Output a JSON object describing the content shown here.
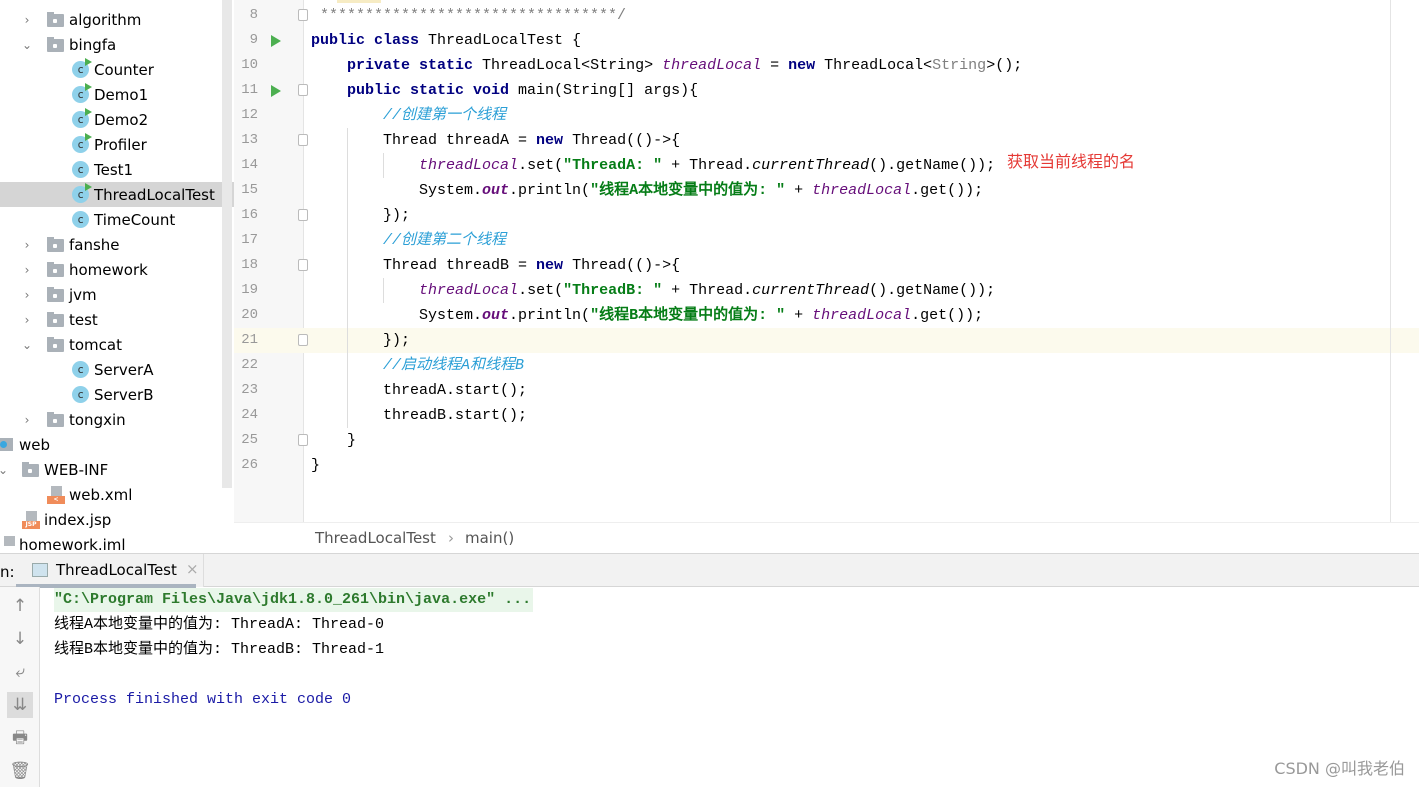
{
  "sidebar": {
    "items": [
      {
        "label": "algorithm",
        "type": "folder",
        "expanded": false
      },
      {
        "label": "bingfa",
        "type": "folder",
        "expanded": true
      },
      {
        "label": "Counter",
        "type": "class-runnable"
      },
      {
        "label": "Demo1",
        "type": "class-runnable"
      },
      {
        "label": "Demo2",
        "type": "class-runnable"
      },
      {
        "label": "Profiler",
        "type": "class-runnable"
      },
      {
        "label": "Test1",
        "type": "class"
      },
      {
        "label": "ThreadLocalTest",
        "type": "class-runnable",
        "selected": true
      },
      {
        "label": "TimeCount",
        "type": "class"
      },
      {
        "label": "fanshe",
        "type": "folder",
        "expanded": false
      },
      {
        "label": "homework",
        "type": "folder",
        "expanded": false
      },
      {
        "label": "jvm",
        "type": "folder",
        "expanded": false
      },
      {
        "label": "test",
        "type": "folder",
        "expanded": false
      },
      {
        "label": "tomcat",
        "type": "folder",
        "expanded": true
      },
      {
        "label": "ServerA",
        "type": "class"
      },
      {
        "label": "ServerB",
        "type": "class"
      },
      {
        "label": "tongxin",
        "type": "folder",
        "expanded": false
      },
      {
        "label": "web",
        "type": "web-folder"
      },
      {
        "label": "WEB-INF",
        "type": "folder",
        "expanded": true
      },
      {
        "label": "web.xml",
        "type": "xml-file",
        "tag": "<"
      },
      {
        "label": "index.jsp",
        "type": "jsp-file",
        "tag": "JSP"
      },
      {
        "label": "homework.iml",
        "type": "iml-file"
      }
    ]
  },
  "editor": {
    "colors": {
      "kw": "#000080",
      "cls": "#000000",
      "field": "#660e7a",
      "comment": "#2b9fd6",
      "str": "#067d17",
      "plain": "#000000",
      "gray": "#808080"
    },
    "lines": [
      {
        "n": "8",
        "fold": true,
        "tokens": [
          {
            "t": " *********************************/",
            "c": "gray"
          }
        ]
      },
      {
        "n": "9",
        "run": true,
        "tokens": [
          {
            "t": "public class ",
            "c": "kw",
            "b": 1
          },
          {
            "t": "ThreadLocalTest {",
            "c": "plain"
          }
        ]
      },
      {
        "n": "10",
        "tokens": [
          {
            "t": "    "
          },
          {
            "t": "private static ",
            "c": "kw",
            "b": 1
          },
          {
            "t": "ThreadLocal<String> ",
            "c": "plain"
          },
          {
            "t": "threadLocal",
            "c": "field",
            "i": 1
          },
          {
            "t": " = "
          },
          {
            "t": "new ",
            "c": "kw",
            "b": 1
          },
          {
            "t": "ThreadLocal<"
          },
          {
            "t": "String",
            "c": "gray"
          },
          {
            "t": ">();"
          }
        ]
      },
      {
        "n": "11",
        "run": true,
        "fold": true,
        "tokens": [
          {
            "t": "    "
          },
          {
            "t": "public static void ",
            "c": "kw",
            "b": 1
          },
          {
            "t": "main(String[] args){"
          }
        ]
      },
      {
        "n": "12",
        "tokens": [
          {
            "t": "        "
          },
          {
            "t": "//创建第一个线程",
            "c": "comment",
            "i": 1
          }
        ]
      },
      {
        "n": "13",
        "fold": true,
        "tokens": [
          {
            "t": "        Thread threadA = "
          },
          {
            "t": "new ",
            "c": "kw",
            "b": 1
          },
          {
            "t": "Thread(()->{"
          }
        ]
      },
      {
        "n": "14",
        "tokens": [
          {
            "t": "            "
          },
          {
            "t": "threadLocal",
            "c": "field",
            "i": 1
          },
          {
            "t": ".set("
          },
          {
            "t": "\"ThreadA: \"",
            "c": "str",
            "b": 1
          },
          {
            "t": " + Thread."
          },
          {
            "t": "currentThread",
            "i": 1
          },
          {
            "t": "().getName());"
          }
        ]
      },
      {
        "n": "15",
        "tokens": [
          {
            "t": "            System."
          },
          {
            "t": "out",
            "c": "field",
            "b": 1,
            "i": 1
          },
          {
            "t": ".println("
          },
          {
            "t": "\"线程A本地变量中的值为: \"",
            "c": "str",
            "b": 1
          },
          {
            "t": " + "
          },
          {
            "t": "threadLocal",
            "c": "field",
            "i": 1
          },
          {
            "t": ".get());"
          }
        ]
      },
      {
        "n": "16",
        "fold": true,
        "tokens": [
          {
            "t": "        });"
          }
        ]
      },
      {
        "n": "17",
        "tokens": [
          {
            "t": "        "
          },
          {
            "t": "//创建第二个线程",
            "c": "comment",
            "i": 1
          }
        ]
      },
      {
        "n": "18",
        "fold": true,
        "tokens": [
          {
            "t": "        Thread threadB = "
          },
          {
            "t": "new ",
            "c": "kw",
            "b": 1
          },
          {
            "t": "Thread(()->{"
          }
        ]
      },
      {
        "n": "19",
        "tokens": [
          {
            "t": "            "
          },
          {
            "t": "threadLocal",
            "c": "field",
            "i": 1
          },
          {
            "t": ".set("
          },
          {
            "t": "\"ThreadB: \"",
            "c": "str",
            "b": 1
          },
          {
            "t": " + Thread."
          },
          {
            "t": "currentThread",
            "i": 1
          },
          {
            "t": "().getName());"
          }
        ]
      },
      {
        "n": "20",
        "tokens": [
          {
            "t": "            System."
          },
          {
            "t": "out",
            "c": "field",
            "b": 1,
            "i": 1
          },
          {
            "t": ".println("
          },
          {
            "t": "\"线程B本地变量中的值为: \"",
            "c": "str",
            "b": 1
          },
          {
            "t": " + "
          },
          {
            "t": "threadLocal",
            "c": "field",
            "i": 1
          },
          {
            "t": ".get());"
          }
        ]
      },
      {
        "n": "21",
        "fold": true,
        "current": true,
        "tokens": [
          {
            "t": "        });"
          }
        ]
      },
      {
        "n": "22",
        "tokens": [
          {
            "t": "        "
          },
          {
            "t": "//启动线程A和线程B",
            "c": "comment",
            "i": 1
          }
        ]
      },
      {
        "n": "23",
        "tokens": [
          {
            "t": "        threadA.start();"
          }
        ]
      },
      {
        "n": "24",
        "tokens": [
          {
            "t": "        threadB.start();"
          }
        ]
      },
      {
        "n": "25",
        "fold": true,
        "tokens": [
          {
            "t": "    }"
          }
        ]
      },
      {
        "n": "26",
        "tokens": [
          {
            "t": "}"
          }
        ]
      }
    ],
    "annotation": "获取当前线程的名"
  },
  "breadcrumb": {
    "class": "ThreadLocalTest",
    "sep": "›",
    "method": "main()"
  },
  "run_panel": {
    "label": "n:",
    "tab": "ThreadLocalTest",
    "close": "×",
    "console": {
      "command": "\"C:\\Program Files\\Java\\jdk1.8.0_261\\bin\\java.exe\" ...",
      "out1": "线程A本地变量中的值为: ThreadA: Thread-0",
      "out2": "线程B本地变量中的值为: ThreadB: Thread-1",
      "exit": "Process finished with exit code 0"
    },
    "tools": [
      {
        "name": "up-arrow-icon",
        "glyph": "↑"
      },
      {
        "name": "down-arrow-icon",
        "glyph": "↓"
      },
      {
        "name": "soft-wrap-icon",
        "glyph": "⤶"
      },
      {
        "name": "scroll-to-end-icon",
        "glyph": "⇊",
        "active": true
      },
      {
        "name": "print-icon",
        "glyph": "🖶"
      },
      {
        "name": "trash-icon",
        "glyph": "🗑"
      }
    ]
  },
  "watermark": "CSDN @叫我老伯"
}
